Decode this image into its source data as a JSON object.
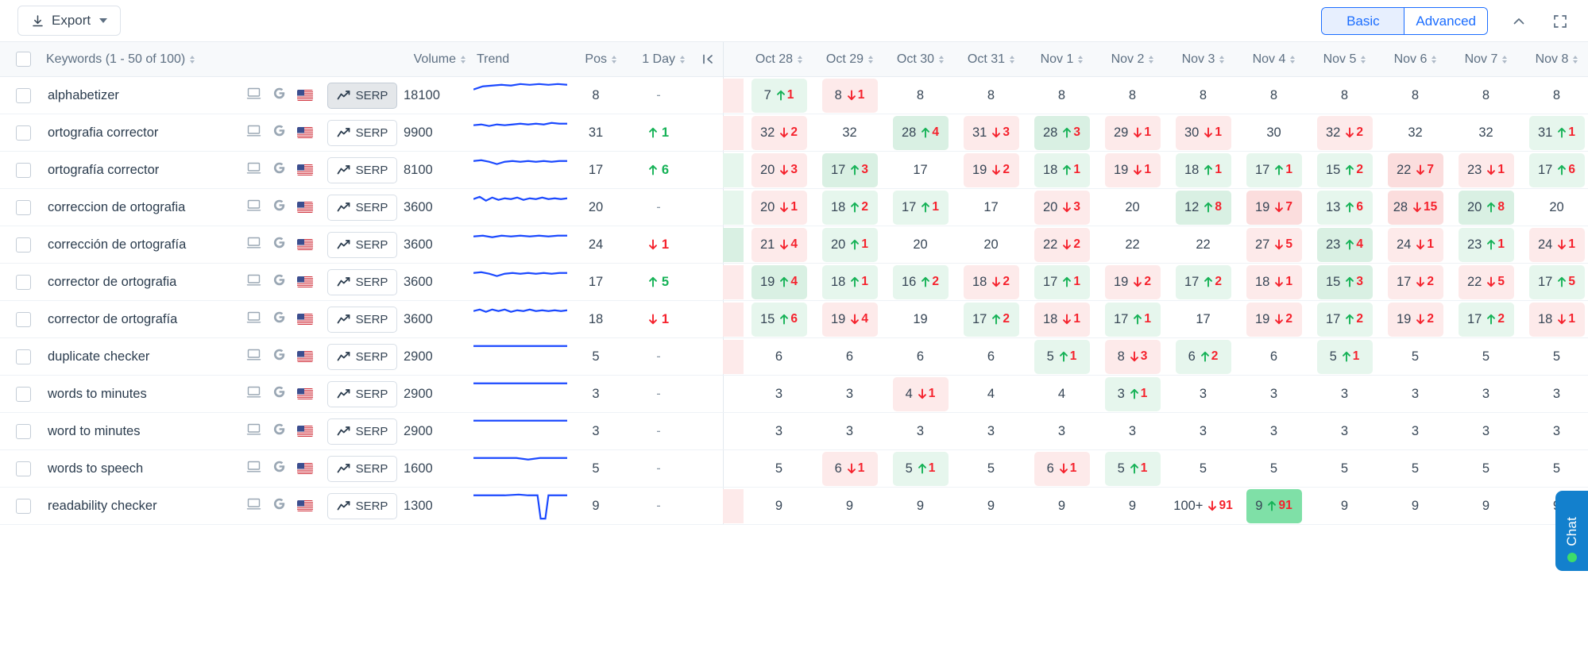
{
  "toolbar": {
    "export_label": "Export",
    "download_icon": "download-icon",
    "caret_icon": "chevron-down-icon",
    "basic_label": "Basic",
    "advanced_label": "Advanced",
    "collapse_icon": "chevron-up-icon",
    "fullscreen_icon": "fullscreen-icon",
    "accent": "#1b6dff"
  },
  "table": {
    "headers": {
      "keywords": "Keywords (1 - 50 of 100)",
      "volume": "Volume",
      "trend": "Trend",
      "pos": "Pos",
      "one_day": "1 Day",
      "collapse_icon": "collapse-left-icon"
    },
    "dates": [
      "Oct 28",
      "Oct 29",
      "Oct 30",
      "Oct 31",
      "Nov 1",
      "Nov 2",
      "Nov 3",
      "Nov 4",
      "Nov 5",
      "Nov 6",
      "Nov 7",
      "Nov 8"
    ],
    "serp_label": "SERP",
    "device_icon": "desktop-icon",
    "engine_icon": "google-icon",
    "country_icon": "us-flag-icon",
    "rows": [
      {
        "keyword": "alphabetizer",
        "volume": "18100",
        "pos": "8",
        "one_day": "-",
        "one_day_dir": "none",
        "serp_selected": true,
        "spark": "0,16 12,12 24,11 36,10 48,11 60,9 72,10 84,9 96,10 108,9 120,10",
        "clip": "dn",
        "cells": [
          {
            "v": "7",
            "d": "1",
            "dir": "up"
          },
          {
            "v": "8",
            "d": "1",
            "dir": "dn"
          },
          {
            "v": "8",
            "d": "",
            "dir": "none"
          },
          {
            "v": "8",
            "d": "",
            "dir": "none"
          },
          {
            "v": "8",
            "d": "",
            "dir": "none"
          },
          {
            "v": "8",
            "d": "",
            "dir": "none"
          },
          {
            "v": "8",
            "d": "",
            "dir": "none"
          },
          {
            "v": "8",
            "d": "",
            "dir": "none"
          },
          {
            "v": "8",
            "d": "",
            "dir": "none"
          },
          {
            "v": "8",
            "d": "",
            "dir": "none"
          },
          {
            "v": "8",
            "d": "",
            "dir": "none"
          },
          {
            "v": "8",
            "d": "",
            "dir": "none"
          }
        ]
      },
      {
        "keyword": "ortografia corrector",
        "volume": "9900",
        "pos": "31",
        "one_day": "1",
        "one_day_dir": "up",
        "serp_selected": false,
        "spark": "0,14 10,13 20,15 30,13 40,14 50,13 60,12 70,13 80,12 90,13 100,11 110,12 120,12",
        "clip": "dn",
        "cells": [
          {
            "v": "32",
            "d": "2",
            "dir": "dn"
          },
          {
            "v": "32",
            "d": "",
            "dir": "none"
          },
          {
            "v": "28",
            "d": "4",
            "dir": "up2"
          },
          {
            "v": "31",
            "d": "3",
            "dir": "dn"
          },
          {
            "v": "28",
            "d": "3",
            "dir": "up2"
          },
          {
            "v": "29",
            "d": "1",
            "dir": "dn"
          },
          {
            "v": "30",
            "d": "1",
            "dir": "dn"
          },
          {
            "v": "30",
            "d": "",
            "dir": "none"
          },
          {
            "v": "32",
            "d": "2",
            "dir": "dn"
          },
          {
            "v": "32",
            "d": "",
            "dir": "none"
          },
          {
            "v": "32",
            "d": "",
            "dir": "none"
          },
          {
            "v": "31",
            "d": "1",
            "dir": "up"
          }
        ]
      },
      {
        "keyword": "ortografía corrector",
        "volume": "8100",
        "pos": "17",
        "one_day": "6",
        "one_day_dir": "up",
        "serp_selected": false,
        "spark": "0,12 10,11 20,13 30,16 40,13 50,12 60,13 70,12 80,13 90,12 100,13 110,12 120,12",
        "clip": "up",
        "cells": [
          {
            "v": "20",
            "d": "3",
            "dir": "dn"
          },
          {
            "v": "17",
            "d": "3",
            "dir": "up2"
          },
          {
            "v": "17",
            "d": "",
            "dir": "none"
          },
          {
            "v": "19",
            "d": "2",
            "dir": "dn"
          },
          {
            "v": "18",
            "d": "1",
            "dir": "up"
          },
          {
            "v": "19",
            "d": "1",
            "dir": "dn"
          },
          {
            "v": "18",
            "d": "1",
            "dir": "up"
          },
          {
            "v": "17",
            "d": "1",
            "dir": "up"
          },
          {
            "v": "15",
            "d": "2",
            "dir": "up"
          },
          {
            "v": "22",
            "d": "7",
            "dir": "dn2"
          },
          {
            "v": "23",
            "d": "1",
            "dir": "dn"
          },
          {
            "v": "17",
            "d": "6",
            "dir": "up"
          }
        ]
      },
      {
        "keyword": "correccion de ortografia",
        "volume": "3600",
        "pos": "20",
        "one_day": "-",
        "one_day_dir": "none",
        "serp_selected": false,
        "spark": "0,13 8,10 16,15 24,11 32,14 40,12 48,13 56,11 64,14 72,12 80,13 88,11 96,13 104,12 112,13 120,12",
        "clip": "up",
        "cells": [
          {
            "v": "20",
            "d": "1",
            "dir": "dn"
          },
          {
            "v": "18",
            "d": "2",
            "dir": "up"
          },
          {
            "v": "17",
            "d": "1",
            "dir": "up"
          },
          {
            "v": "17",
            "d": "",
            "dir": "none"
          },
          {
            "v": "20",
            "d": "3",
            "dir": "dn"
          },
          {
            "v": "20",
            "d": "",
            "dir": "none"
          },
          {
            "v": "12",
            "d": "8",
            "dir": "up2"
          },
          {
            "v": "19",
            "d": "7",
            "dir": "dn2"
          },
          {
            "v": "13",
            "d": "6",
            "dir": "up"
          },
          {
            "v": "28",
            "d": "15",
            "dir": "dn2"
          },
          {
            "v": "20",
            "d": "8",
            "dir": "up2"
          },
          {
            "v": "20",
            "d": "",
            "dir": "none"
          }
        ]
      },
      {
        "keyword": "corrección de ortografía",
        "volume": "3600",
        "pos": "24",
        "one_day": "1",
        "one_day_dir": "dn",
        "serp_selected": false,
        "spark": "0,13 12,12 24,14 36,12 48,13 60,12 72,13 84,12 96,13 108,12 120,12",
        "clip": "up2",
        "cells": [
          {
            "v": "21",
            "d": "4",
            "dir": "dn"
          },
          {
            "v": "20",
            "d": "1",
            "dir": "up"
          },
          {
            "v": "20",
            "d": "",
            "dir": "none"
          },
          {
            "v": "20",
            "d": "",
            "dir": "none"
          },
          {
            "v": "22",
            "d": "2",
            "dir": "dn"
          },
          {
            "v": "22",
            "d": "",
            "dir": "none"
          },
          {
            "v": "22",
            "d": "",
            "dir": "none"
          },
          {
            "v": "27",
            "d": "5",
            "dir": "dn"
          },
          {
            "v": "23",
            "d": "4",
            "dir": "up2"
          },
          {
            "v": "24",
            "d": "1",
            "dir": "dn"
          },
          {
            "v": "23",
            "d": "1",
            "dir": "up"
          },
          {
            "v": "24",
            "d": "1",
            "dir": "dn"
          }
        ]
      },
      {
        "keyword": "corrector de ortografia",
        "volume": "3600",
        "pos": "17",
        "one_day": "5",
        "one_day_dir": "up",
        "serp_selected": false,
        "spark": "0,12 10,11 20,13 30,16 40,13 50,12 60,13 70,12 80,13 90,12 100,13 110,12 120,12",
        "clip": "dn",
        "cells": [
          {
            "v": "19",
            "d": "4",
            "dir": "up2"
          },
          {
            "v": "18",
            "d": "1",
            "dir": "up"
          },
          {
            "v": "16",
            "d": "2",
            "dir": "up"
          },
          {
            "v": "18",
            "d": "2",
            "dir": "dn"
          },
          {
            "v": "17",
            "d": "1",
            "dir": "up"
          },
          {
            "v": "19",
            "d": "2",
            "dir": "dn"
          },
          {
            "v": "17",
            "d": "2",
            "dir": "up"
          },
          {
            "v": "18",
            "d": "1",
            "dir": "dn"
          },
          {
            "v": "15",
            "d": "3",
            "dir": "up2"
          },
          {
            "v": "17",
            "d": "2",
            "dir": "dn"
          },
          {
            "v": "22",
            "d": "5",
            "dir": "dn"
          },
          {
            "v": "17",
            "d": "5",
            "dir": "up"
          }
        ]
      },
      {
        "keyword": "corrector de ortografía",
        "volume": "3600",
        "pos": "18",
        "one_day": "1",
        "one_day_dir": "dn",
        "serp_selected": false,
        "spark": "0,13 8,11 16,14 24,11 32,13 40,11 48,14 56,12 64,13 72,11 80,13 88,12 96,13 104,12 112,13 120,12",
        "clip": "dn",
        "cells": [
          {
            "v": "15",
            "d": "6",
            "dir": "up"
          },
          {
            "v": "19",
            "d": "4",
            "dir": "dn"
          },
          {
            "v": "19",
            "d": "",
            "dir": "none"
          },
          {
            "v": "17",
            "d": "2",
            "dir": "up"
          },
          {
            "v": "18",
            "d": "1",
            "dir": "dn"
          },
          {
            "v": "17",
            "d": "1",
            "dir": "up"
          },
          {
            "v": "17",
            "d": "",
            "dir": "none"
          },
          {
            "v": "19",
            "d": "2",
            "dir": "dn"
          },
          {
            "v": "17",
            "d": "2",
            "dir": "up"
          },
          {
            "v": "19",
            "d": "2",
            "dir": "dn"
          },
          {
            "v": "17",
            "d": "2",
            "dir": "up"
          },
          {
            "v": "18",
            "d": "1",
            "dir": "dn"
          }
        ]
      },
      {
        "keyword": "duplicate checker",
        "volume": "2900",
        "pos": "5",
        "one_day": "-",
        "one_day_dir": "none",
        "serp_selected": false,
        "spark": "0,10 20,10 40,10 60,10 80,10 100,10 120,10",
        "clip": "dn",
        "cells": [
          {
            "v": "6",
            "d": "",
            "dir": "none"
          },
          {
            "v": "6",
            "d": "",
            "dir": "none"
          },
          {
            "v": "6",
            "d": "",
            "dir": "none"
          },
          {
            "v": "6",
            "d": "",
            "dir": "none"
          },
          {
            "v": "5",
            "d": "1",
            "dir": "up"
          },
          {
            "v": "8",
            "d": "3",
            "dir": "dn"
          },
          {
            "v": "6",
            "d": "2",
            "dir": "up"
          },
          {
            "v": "6",
            "d": "",
            "dir": "none"
          },
          {
            "v": "5",
            "d": "1",
            "dir": "up"
          },
          {
            "v": "5",
            "d": "",
            "dir": "none"
          },
          {
            "v": "5",
            "d": "",
            "dir": "none"
          },
          {
            "v": "5",
            "d": "",
            "dir": "none"
          }
        ]
      },
      {
        "keyword": "words to minutes",
        "volume": "2900",
        "pos": "3",
        "one_day": "-",
        "one_day_dir": "none",
        "serp_selected": false,
        "spark": "0,10 20,10 40,10 60,10 80,10 100,10 120,10",
        "clip": "none",
        "cells": [
          {
            "v": "3",
            "d": "",
            "dir": "none"
          },
          {
            "v": "3",
            "d": "",
            "dir": "none"
          },
          {
            "v": "4",
            "d": "1",
            "dir": "dn"
          },
          {
            "v": "4",
            "d": "",
            "dir": "none"
          },
          {
            "v": "4",
            "d": "",
            "dir": "none"
          },
          {
            "v": "3",
            "d": "1",
            "dir": "up"
          },
          {
            "v": "3",
            "d": "",
            "dir": "none"
          },
          {
            "v": "3",
            "d": "",
            "dir": "none"
          },
          {
            "v": "3",
            "d": "",
            "dir": "none"
          },
          {
            "v": "3",
            "d": "",
            "dir": "none"
          },
          {
            "v": "3",
            "d": "",
            "dir": "none"
          },
          {
            "v": "3",
            "d": "",
            "dir": "none"
          }
        ]
      },
      {
        "keyword": "word to minutes",
        "volume": "2900",
        "pos": "3",
        "one_day": "-",
        "one_day_dir": "none",
        "serp_selected": false,
        "spark": "0,10 20,10 40,10 60,10 80,10 100,10 120,10",
        "clip": "none",
        "cells": [
          {
            "v": "3",
            "d": "",
            "dir": "none"
          },
          {
            "v": "3",
            "d": "",
            "dir": "none"
          },
          {
            "v": "3",
            "d": "",
            "dir": "none"
          },
          {
            "v": "3",
            "d": "",
            "dir": "none"
          },
          {
            "v": "3",
            "d": "",
            "dir": "none"
          },
          {
            "v": "3",
            "d": "",
            "dir": "none"
          },
          {
            "v": "3",
            "d": "",
            "dir": "none"
          },
          {
            "v": "3",
            "d": "",
            "dir": "none"
          },
          {
            "v": "3",
            "d": "",
            "dir": "none"
          },
          {
            "v": "3",
            "d": "",
            "dir": "none"
          },
          {
            "v": "3",
            "d": "",
            "dir": "none"
          },
          {
            "v": "3",
            "d": "",
            "dir": "none"
          }
        ]
      },
      {
        "keyword": "words to speech",
        "volume": "1600",
        "pos": "5",
        "one_day": "-",
        "one_day_dir": "none",
        "serp_selected": false,
        "spark": "0,10 30,10 55,10 70,12 85,10 100,10 120,10",
        "clip": "none",
        "cells": [
          {
            "v": "5",
            "d": "",
            "dir": "none"
          },
          {
            "v": "6",
            "d": "1",
            "dir": "dn"
          },
          {
            "v": "5",
            "d": "1",
            "dir": "up"
          },
          {
            "v": "5",
            "d": "",
            "dir": "none"
          },
          {
            "v": "6",
            "d": "1",
            "dir": "dn"
          },
          {
            "v": "5",
            "d": "1",
            "dir": "up"
          },
          {
            "v": "5",
            "d": "",
            "dir": "none"
          },
          {
            "v": "5",
            "d": "",
            "dir": "none"
          },
          {
            "v": "5",
            "d": "",
            "dir": "none"
          },
          {
            "v": "5",
            "d": "",
            "dir": "none"
          },
          {
            "v": "5",
            "d": "",
            "dir": "none"
          },
          {
            "v": "5",
            "d": "",
            "dir": "none"
          }
        ]
      },
      {
        "keyword": "readability checker",
        "volume": "1300",
        "pos": "9",
        "one_day": "-",
        "one_day_dir": "none",
        "serp_selected": false,
        "spark": "0,10 40,10 58,9 70,10 82,10 86,40 92,40 96,10 110,10 120,10",
        "clip": "dn",
        "cells": [
          {
            "v": "9",
            "d": "",
            "dir": "none"
          },
          {
            "v": "9",
            "d": "",
            "dir": "none"
          },
          {
            "v": "9",
            "d": "",
            "dir": "none"
          },
          {
            "v": "9",
            "d": "",
            "dir": "none"
          },
          {
            "v": "9",
            "d": "",
            "dir": "none"
          },
          {
            "v": "9",
            "d": "",
            "dir": "none"
          },
          {
            "v": "100+",
            "d": "91",
            "dir": "dnplain"
          },
          {
            "v": "9",
            "d": "91",
            "dir": "up3"
          },
          {
            "v": "9",
            "d": "",
            "dir": "none"
          },
          {
            "v": "9",
            "d": "",
            "dir": "none"
          },
          {
            "v": "9",
            "d": "",
            "dir": "none"
          },
          {
            "v": "9",
            "d": "",
            "dir": "none"
          }
        ]
      }
    ]
  },
  "chat": {
    "label": "Chat",
    "status_color": "#3ddc6b",
    "bg": "#1380cd"
  }
}
